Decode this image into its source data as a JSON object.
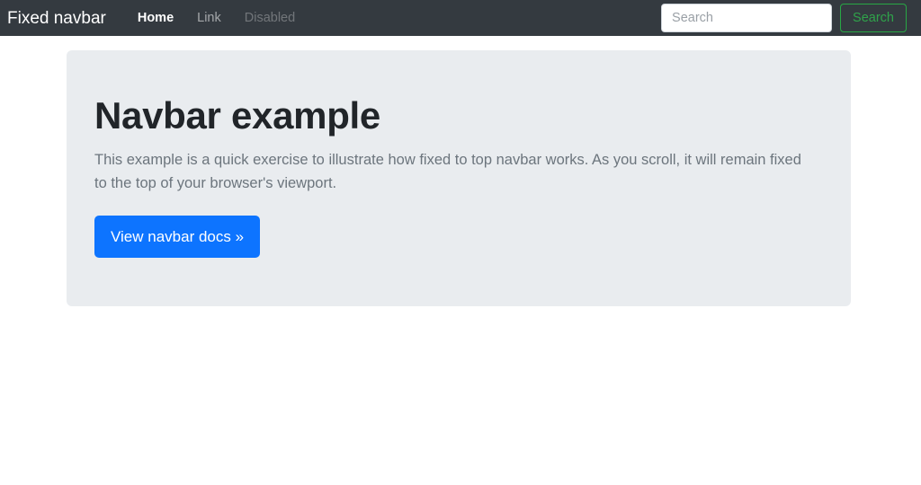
{
  "colors": {
    "navbar_bg": "#343a40",
    "page_bg": "#ffffff",
    "jumbotron_bg": "#e9ecef",
    "primary": "#0d74ff",
    "success": "#28a745",
    "muted_text": "#6c757d",
    "heading_text": "#212529"
  },
  "navbar": {
    "brand": "Fixed navbar",
    "items": [
      {
        "label": "Home",
        "state": "active"
      },
      {
        "label": "Link",
        "state": "normal"
      },
      {
        "label": "Disabled",
        "state": "disabled"
      }
    ],
    "search": {
      "placeholder": "Search",
      "value": "",
      "button_label": "Search"
    }
  },
  "main": {
    "jumbotron": {
      "title": "Navbar example",
      "lead": "This example is a quick exercise to illustrate how fixed to top navbar works. As you scroll, it will remain fixed to the top of your browser's viewport.",
      "button_label": "View navbar docs »"
    }
  }
}
